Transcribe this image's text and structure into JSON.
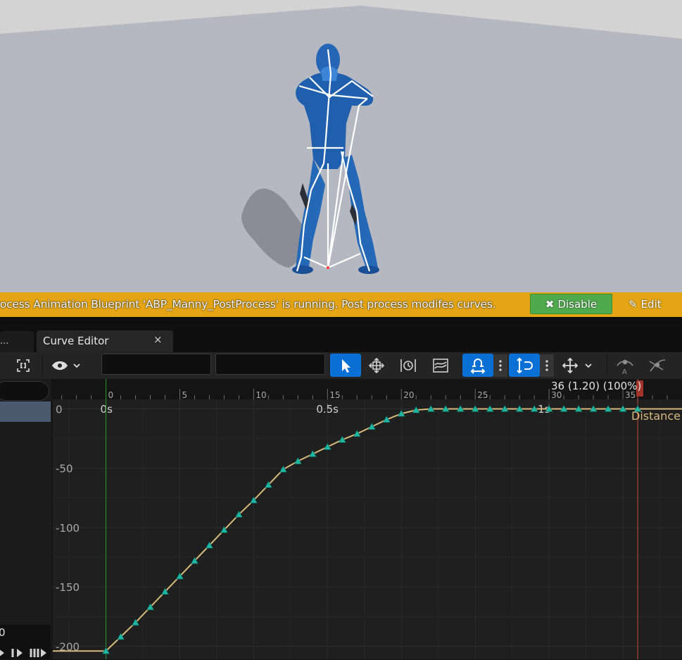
{
  "viewport": {
    "name": "3D viewport",
    "character": "blue mannequin with white debug skeleton"
  },
  "warning_bar": {
    "message": "rocess Animation Blueprint 'ABP_Manny_PostProcess' is running. Post process modifes curves.",
    "disable_label": "Disable",
    "edit_label": "Edit"
  },
  "tabs": [
    {
      "label": "..."
    },
    {
      "label": "Curve Editor",
      "close": "×"
    }
  ],
  "toolbar": {
    "icons": [
      "focus-icon",
      "view-options-icon",
      "select-tool-icon",
      "transform-tool-icon",
      "retime-tool-icon",
      "multi-scale-tool-icon",
      "snap-icon",
      "snap-options-icon",
      "time-snap-icon",
      "time-snap-options-icon",
      "move-axis-icon",
      "tangent-auto-icon",
      "tangent-user-icon"
    ]
  },
  "timeline": {
    "frame_ticks": [
      "0",
      "5",
      "10",
      "15",
      "20",
      "25",
      "30",
      "35"
    ],
    "time_labels": [
      "0s",
      "0.5s",
      "1s"
    ],
    "playhead_label": "36 (1.20) (100%)"
  },
  "left_panel": {
    "bottom_value": "0"
  },
  "chart_data": {
    "type": "line",
    "title": "",
    "xlabel": "",
    "ylabel": "",
    "series": [
      {
        "name": "Distance",
        "x": [
          0,
          1,
          2,
          3,
          4,
          5,
          6,
          7,
          8,
          9,
          10,
          11,
          12,
          13,
          14,
          15,
          16,
          17,
          18,
          19,
          20,
          21,
          22,
          23,
          24,
          25,
          26,
          27,
          28,
          29,
          30,
          31,
          32,
          33,
          34,
          35,
          36
        ],
        "y": [
          -204,
          -192,
          -180,
          -167,
          -154,
          -141,
          -128,
          -115,
          -102,
          -89,
          -77,
          -64,
          -51,
          -44,
          -38,
          -32,
          -26,
          -21,
          -15,
          -9,
          -4,
          -1,
          0,
          0,
          0,
          0,
          0,
          0,
          0,
          0,
          0,
          0,
          0,
          0,
          0,
          0,
          0
        ]
      }
    ],
    "x_unit": "frames",
    "xlim": [
      -3.6,
      39
    ],
    "ylim": [
      -211,
      8
    ],
    "y_ticks": [
      "0",
      "-50",
      "-100",
      "-150",
      "-200"
    ],
    "line_color": "#d7b97b",
    "key_color": "#1fb5a3",
    "start_marker_color": "#1e9c2c",
    "end_marker_color": "#c84a3e"
  }
}
